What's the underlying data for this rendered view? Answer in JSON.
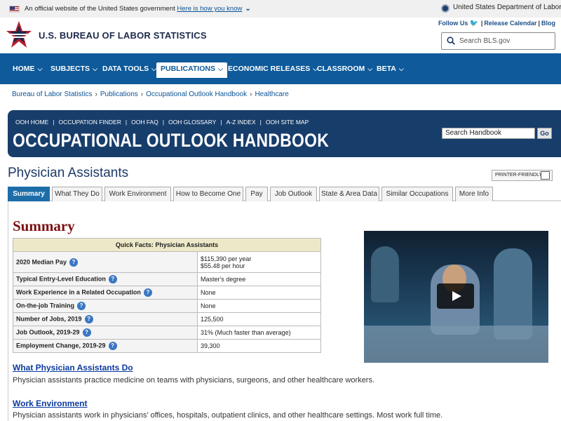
{
  "govbanner": {
    "text": "An official website of the United States government",
    "link": "Here is how you know"
  },
  "dol": {
    "label": "United States Department of Labor"
  },
  "header": {
    "agency": "U.S. BUREAU OF LABOR STATISTICS",
    "follow_us": "Follow Us",
    "release_calendar": "Release Calendar",
    "blog": "Blog",
    "search_placeholder": "Search BLS.gov"
  },
  "nav": {
    "items": [
      "HOME",
      "SUBJECTS",
      "DATA TOOLS",
      "PUBLICATIONS",
      "ECONOMIC RELEASES",
      "CLASSROOM",
      "BETA"
    ],
    "active": "PUBLICATIONS"
  },
  "breadcrumb": [
    "Bureau of Labor Statistics",
    "Publications",
    "Occupational Outlook Handbook",
    "Healthcare"
  ],
  "ooh": {
    "links": [
      "OOH HOME",
      "OCCUPATION FINDER",
      "OOH FAQ",
      "OOH GLOSSARY",
      "A-Z INDEX",
      "OOH SITE MAP"
    ],
    "title": "OCCUPATIONAL OUTLOOK HANDBOOK",
    "search_value": "Search Handbook",
    "go": "Go"
  },
  "occupation_title": "Physician Assistants",
  "printer_label": "PRINTER-FRIENDLY",
  "tabs": [
    "Summary",
    "What They Do",
    "Work Environment",
    "How to Become One",
    "Pay",
    "Job Outlook",
    "State & Area Data",
    "Similar Occupations",
    "More Info"
  ],
  "summary_heading": "Summary",
  "quick_facts": {
    "caption": "Quick Facts: Physician Assistants",
    "rows": [
      {
        "label": "2020 Median Pay",
        "value": "$115,390 per year",
        "value2": "$55.48 per hour"
      },
      {
        "label": "Typical Entry-Level Education",
        "value": "Master's degree"
      },
      {
        "label": "Work Experience in a Related Occupation",
        "value": "None"
      },
      {
        "label": "On-the-job Training",
        "value": "None"
      },
      {
        "label": "Number of Jobs, 2019",
        "value": "125,500"
      },
      {
        "label": "Job Outlook, 2019-29",
        "value": "31% (Much faster than average)"
      },
      {
        "label": "Employment Change, 2019-29",
        "value": "39,300"
      }
    ]
  },
  "sections": [
    {
      "title": "What Physician Assistants Do",
      "text": "Physician assistants practice medicine on teams with physicians, surgeons, and other healthcare workers."
    },
    {
      "title": "Work Environment",
      "text": "Physician assistants work in physicians’ offices, hospitals, outpatient clinics, and other healthcare settings. Most work full time."
    }
  ],
  "colors": {
    "nav": "#0e5a9a",
    "ooh_banner": "#173d6b",
    "summary_red": "#7a1010",
    "active_tab": "#1d6da8"
  }
}
